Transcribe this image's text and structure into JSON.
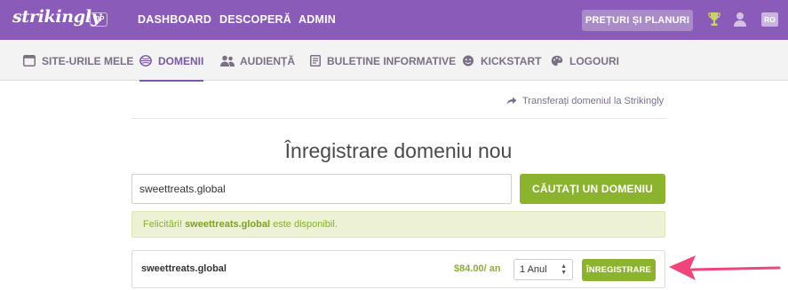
{
  "topbar": {
    "logo": "strikingly",
    "vip_badge": "VIP",
    "nav": [
      "DASHBOARD",
      "DESCOPERĂ",
      "ADMIN"
    ],
    "pricing_button": "PREȚURI ȘI PLANURI",
    "language": "RO",
    "icons": [
      "trophy-icon",
      "user-icon"
    ],
    "background_color": "#8a5bb8"
  },
  "subnav": {
    "items": [
      {
        "label": "SITE-URILE MELE",
        "icon": "browser-window-icon"
      },
      {
        "label": "DOMENII",
        "icon": "globe-icon",
        "active": true
      },
      {
        "label": "AUDIENȚĂ",
        "icon": "people-icon"
      },
      {
        "label": "BULETINE INFORMATIVE",
        "icon": "newsletter-icon"
      },
      {
        "label": "KICKSTART",
        "icon": "face-icon"
      },
      {
        "label": "LOGOURI",
        "icon": "palette-icon"
      }
    ]
  },
  "main": {
    "transfer_link": "Transferați domeniul la Strikingly",
    "title": "Înregistrare domeniu nou",
    "search": {
      "value": "sweettreats.global",
      "button": "CĂUTAȚI UN DOMENIU"
    },
    "alert": {
      "prefix": "Felicitări! ",
      "domain": "sweettreats.global",
      "suffix": " este disponibil."
    },
    "result": {
      "domain": "sweettreats.global",
      "price": "$84.00/ an",
      "period": "1 Anul",
      "register_button": "ÎNREGISTRARE"
    }
  },
  "colors": {
    "accent_green": "#8cb32d",
    "alert_bg": "#ecf2d3",
    "arrow_pink": "#f0457a"
  }
}
